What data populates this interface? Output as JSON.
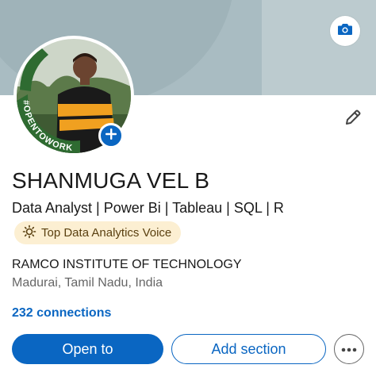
{
  "profile": {
    "name": "SHANMUGA VEL B",
    "headline": "Data Analyst | Power Bi | Tableau | SQL | R",
    "badge": "Top Data Analytics Voice",
    "education": "RAMCO INSTITUTE OF TECHNOLOGY",
    "location": "Madurai, Tamil Nadu, India",
    "connections": "232 connections",
    "photo_frame_text": "#OPENTOWORK"
  },
  "actions": {
    "open_to": "Open to",
    "add_section": "Add section"
  },
  "icons": {
    "cover_camera": "camera-icon",
    "edit": "pencil-icon",
    "add_photo": "plus-icon",
    "badge": "lightbulb-icon",
    "more": "more-horizontal-icon"
  },
  "colors": {
    "brand_blue": "#0a66c2",
    "open_to_work_green": "#2e6b31",
    "badge_bg": "#fcefd2",
    "cover": "#a9bcc2"
  }
}
